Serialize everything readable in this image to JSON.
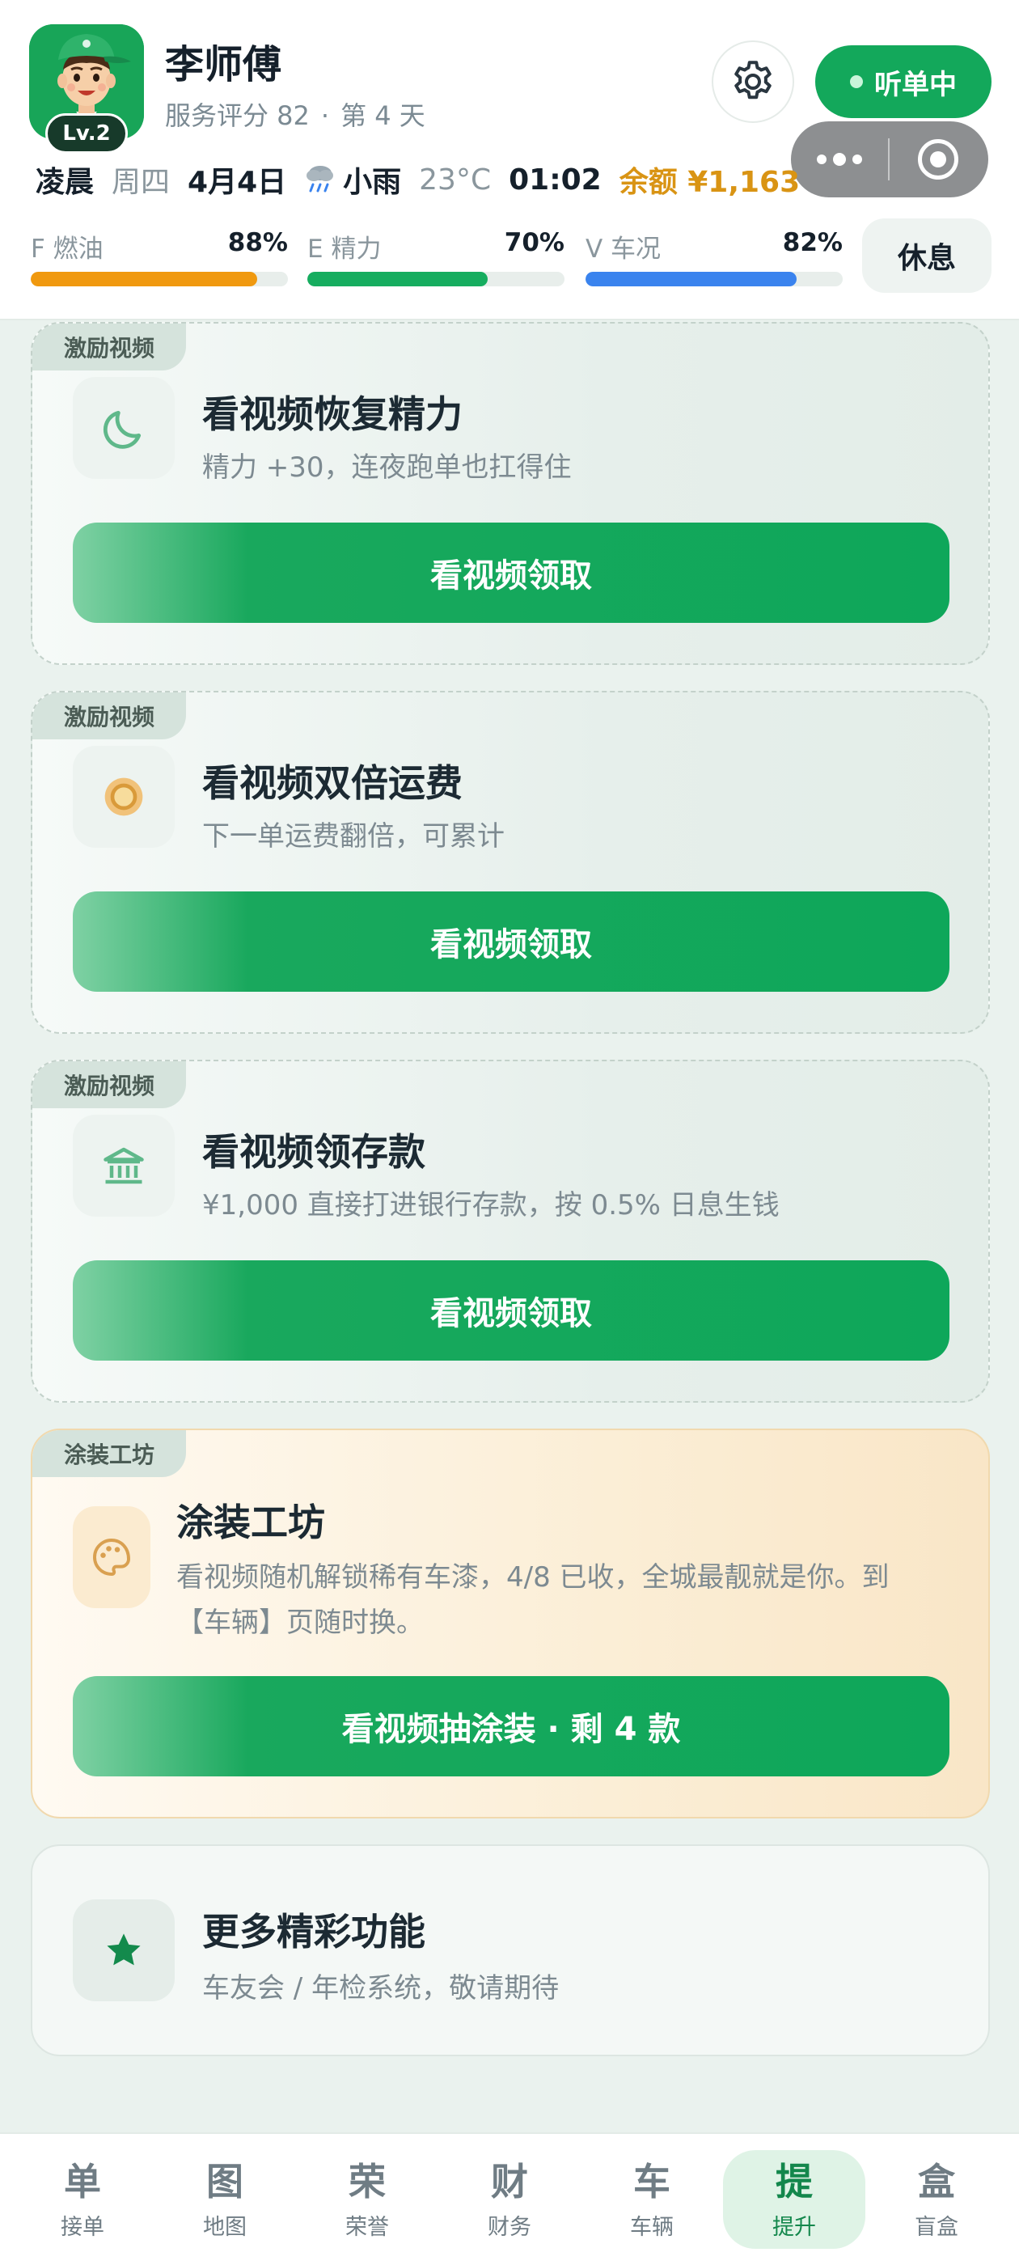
{
  "header": {
    "level": "Lv.2",
    "driver_name": "李师傅",
    "service_score": "服务评分 82",
    "separator": "·",
    "day_count": "第 4 天",
    "listen_label": "听单中",
    "rest_label": "休息"
  },
  "info_row": {
    "period": "凌晨",
    "weekday": "周四",
    "date": "4月4日",
    "weather": "小雨",
    "temperature": "23°C",
    "time": "01:02",
    "balance": "余额 ¥1,163"
  },
  "stats": [
    {
      "label": "F 燃油",
      "value": "88%",
      "fraction": 0.88,
      "color": "#f0990f"
    },
    {
      "label": "E 精力",
      "value": "70%",
      "fraction": 0.7,
      "color": "#16ad5f"
    },
    {
      "label": "V 车况",
      "value": "82%",
      "fraction": 0.82,
      "color": "#3a83ee"
    }
  ],
  "cards": [
    {
      "tag": "激励视频",
      "icon": "moon-icon",
      "title": "看视频恢复精力",
      "desc": "精力 +30，连夜跑单也扛得住",
      "button": "看视频领取"
    },
    {
      "tag": "激励视频",
      "icon": "coin-icon",
      "title": "看视频双倍运费",
      "desc": "下一单运费翻倍，可累计",
      "button": "看视频领取"
    },
    {
      "tag": "激励视频",
      "icon": "bank-icon",
      "title": "看视频领存款",
      "desc": "¥1,000 直接打进银行存款，按 0.5% 日息生钱",
      "button": "看视频领取"
    }
  ],
  "paint_card": {
    "tag": "涂装工坊",
    "icon": "palette-icon",
    "title": "涂装工坊",
    "desc_line1": "看视频随机解锁稀有车漆，4/8 已收，全城最靓就是你。到",
    "desc_line2": "【车辆】页随时换。",
    "button": "看视频抽涂装 · 剩 4 款"
  },
  "more_card": {
    "icon": "star-icon",
    "title": "更多精彩功能",
    "desc": "车友会 / 年检系统，敬请期待"
  },
  "nav": [
    {
      "icon": "单",
      "label": "接单",
      "active": false
    },
    {
      "icon": "图",
      "label": "地图",
      "active": false
    },
    {
      "icon": "荣",
      "label": "荣誉",
      "active": false
    },
    {
      "icon": "财",
      "label": "财务",
      "active": false
    },
    {
      "icon": "车",
      "label": "车辆",
      "active": false
    },
    {
      "icon": "提",
      "label": "提升",
      "active": true
    },
    {
      "icon": "盒",
      "label": "盲盒",
      "active": false
    }
  ],
  "colors": {
    "brand_green": "#13a85b",
    "balance_gold": "#d99414",
    "active_nav": "#13874c"
  }
}
